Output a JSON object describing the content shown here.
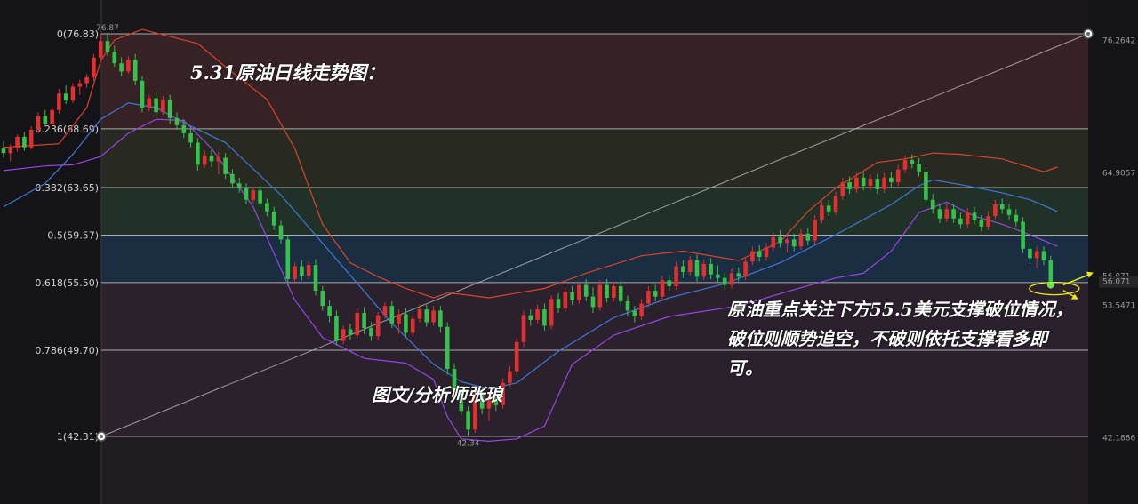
{
  "title": "5.31原油日线走势图：",
  "author": "图文/分析师张琅",
  "comment": "原油重点关注下方55.5美元支撑破位情况，破位则顺势追空，不破则依托支撑看多即可。",
  "colors": {
    "background": "#141317",
    "up": "#e0302f",
    "down": "#34c24a",
    "ma_mid": "#3e78d8",
    "band_upper": "#d8452c",
    "band_lower": "#9846e4",
    "fib_line": "#d9d9d9",
    "zone_top": "#3a2526",
    "zone_mid1": "#2a2e24",
    "zone_mid2": "#23352a",
    "zone_mid3": "#1b3146",
    "zone_bottom": "#2c2330",
    "arrow": "#e8e81c"
  },
  "chart_data": {
    "type": "candlestick",
    "title": "",
    "ylim": [
      39.0,
      78.0
    ],
    "fib_levels": [
      {
        "ratio": "0",
        "price": 76.83,
        "label": "0(76.83)"
      },
      {
        "ratio": "0.236",
        "price": 68.69,
        "label": "0.236(68.69)"
      },
      {
        "ratio": "0.382",
        "price": 63.65,
        "label": "0.382(63.65)"
      },
      {
        "ratio": "0.5",
        "price": 59.57,
        "label": "0.5(59.57)"
      },
      {
        "ratio": "0.618",
        "price": 55.5,
        "label": "0.618(55.50)"
      },
      {
        "ratio": "0.786",
        "price": 49.7,
        "label": "0.786(49.70)"
      },
      {
        "ratio": "1",
        "price": 42.31,
        "label": "1(42.31)"
      }
    ],
    "price_scale_labels": [
      "76.2642",
      "64.9057",
      "56.071",
      "53.5471",
      "42.1886"
    ],
    "extreme_labels": {
      "high": "76.87",
      "low": "42.34"
    },
    "candles": [
      [
        67.0,
        67.6,
        66.2,
        66.6
      ],
      [
        66.6,
        67.4,
        65.9,
        67.0
      ],
      [
        67.0,
        68.2,
        66.7,
        68.0
      ],
      [
        68.0,
        68.4,
        66.8,
        67.1
      ],
      [
        67.1,
        68.9,
        66.9,
        68.6
      ],
      [
        68.6,
        70.1,
        68.3,
        69.8
      ],
      [
        69.8,
        70.3,
        68.9,
        69.1
      ],
      [
        69.1,
        70.6,
        68.8,
        70.3
      ],
      [
        70.3,
        72.1,
        70.0,
        71.7
      ],
      [
        71.7,
        72.4,
        70.8,
        71.1
      ],
      [
        71.1,
        72.6,
        70.9,
        72.3
      ],
      [
        72.3,
        72.9,
        71.6,
        72.6
      ],
      [
        72.6,
        73.4,
        72.2,
        73.1
      ],
      [
        73.1,
        75.1,
        72.8,
        74.8
      ],
      [
        74.8,
        76.87,
        74.4,
        76.2
      ],
      [
        76.2,
        76.9,
        74.9,
        75.3
      ],
      [
        75.3,
        75.8,
        74.0,
        74.3
      ],
      [
        74.3,
        74.8,
        73.2,
        73.6
      ],
      [
        73.6,
        74.9,
        73.4,
        74.6
      ],
      [
        74.6,
        75.1,
        72.4,
        72.8
      ],
      [
        72.8,
        73.2,
        70.1,
        70.5
      ],
      [
        70.5,
        71.6,
        70.2,
        71.3
      ],
      [
        71.3,
        71.9,
        69.8,
        70.1
      ],
      [
        70.1,
        71.5,
        69.9,
        71.2
      ],
      [
        71.2,
        71.6,
        69.1,
        69.6
      ],
      [
        69.6,
        70.1,
        68.6,
        69.0
      ],
      [
        69.0,
        69.5,
        67.9,
        68.3
      ],
      [
        68.3,
        68.8,
        67.1,
        67.5
      ],
      [
        67.5,
        67.9,
        65.1,
        65.6
      ],
      [
        65.6,
        66.8,
        65.3,
        66.4
      ],
      [
        66.4,
        66.9,
        65.4,
        65.9
      ],
      [
        65.9,
        66.7,
        64.8,
        66.2
      ],
      [
        66.2,
        66.6,
        64.4,
        64.8
      ],
      [
        64.8,
        65.2,
        63.6,
        64.0
      ],
      [
        64.0,
        64.5,
        63.2,
        63.6
      ],
      [
        63.6,
        64.0,
        62.2,
        62.6
      ],
      [
        62.6,
        63.7,
        62.3,
        63.4
      ],
      [
        63.4,
        63.8,
        61.9,
        62.3
      ],
      [
        62.3,
        62.7,
        61.2,
        61.6
      ],
      [
        61.6,
        62.0,
        60.0,
        60.4
      ],
      [
        60.4,
        60.8,
        58.8,
        59.2
      ],
      [
        59.2,
        59.6,
        55.2,
        55.8
      ],
      [
        55.8,
        57.2,
        55.4,
        56.9
      ],
      [
        56.9,
        57.4,
        55.7,
        56.1
      ],
      [
        56.1,
        57.3,
        55.8,
        57.0
      ],
      [
        57.0,
        57.5,
        54.4,
        54.8
      ],
      [
        54.8,
        55.2,
        53.1,
        53.5
      ],
      [
        53.5,
        54.0,
        52.1,
        52.6
      ],
      [
        52.6,
        53.1,
        50.1,
        50.5
      ],
      [
        50.5,
        51.8,
        50.2,
        51.5
      ],
      [
        51.5,
        52.0,
        50.6,
        51.0
      ],
      [
        51.0,
        53.3,
        50.7,
        52.9
      ],
      [
        52.9,
        53.4,
        51.1,
        51.6
      ],
      [
        51.6,
        52.1,
        50.5,
        50.9
      ],
      [
        50.9,
        53.0,
        50.6,
        52.7
      ],
      [
        52.7,
        53.8,
        52.4,
        53.5
      ],
      [
        53.5,
        53.9,
        51.6,
        52.0
      ],
      [
        52.0,
        53.2,
        51.1,
        52.8
      ],
      [
        52.8,
        53.3,
        50.8,
        51.2
      ],
      [
        51.2,
        52.7,
        50.9,
        52.4
      ],
      [
        52.4,
        53.6,
        52.1,
        53.2
      ],
      [
        53.2,
        53.6,
        51.7,
        52.1
      ],
      [
        52.1,
        53.5,
        51.8,
        53.1
      ],
      [
        53.1,
        53.5,
        51.2,
        51.7
      ],
      [
        51.7,
        52.1,
        47.6,
        48.1
      ],
      [
        48.1,
        48.6,
        45.8,
        46.3
      ],
      [
        46.3,
        46.7,
        44.1,
        44.5
      ],
      [
        44.5,
        44.9,
        42.34,
        42.9
      ],
      [
        42.9,
        46.4,
        42.6,
        46.0
      ],
      [
        46.0,
        46.5,
        44.2,
        44.7
      ],
      [
        44.7,
        46.1,
        43.6,
        45.7
      ],
      [
        45.7,
        46.2,
        44.5,
        45.0
      ],
      [
        45.0,
        47.3,
        44.7,
        46.9
      ],
      [
        46.9,
        48.3,
        46.6,
        47.9
      ],
      [
        47.9,
        50.8,
        47.6,
        50.4
      ],
      [
        50.4,
        53.1,
        50.0,
        52.7
      ],
      [
        52.7,
        53.2,
        51.8,
        52.3
      ],
      [
        52.3,
        53.6,
        52.0,
        53.2
      ],
      [
        53.2,
        53.7,
        51.4,
        51.8
      ],
      [
        51.8,
        54.4,
        51.5,
        54.1
      ],
      [
        54.1,
        54.6,
        52.9,
        53.3
      ],
      [
        53.3,
        55.1,
        53.0,
        54.7
      ],
      [
        54.7,
        55.2,
        53.6,
        54.0
      ],
      [
        54.0,
        55.6,
        53.7,
        55.3
      ],
      [
        55.3,
        55.8,
        53.9,
        54.3
      ],
      [
        54.3,
        55.1,
        52.9,
        53.4
      ],
      [
        53.4,
        55.7,
        53.1,
        55.3
      ],
      [
        55.3,
        55.8,
        53.8,
        54.2
      ],
      [
        54.2,
        55.6,
        53.9,
        55.2
      ],
      [
        55.2,
        55.6,
        53.5,
        53.9
      ],
      [
        53.9,
        54.4,
        52.6,
        53.1
      ],
      [
        53.1,
        53.5,
        52.1,
        52.6
      ],
      [
        52.6,
        54.1,
        52.3,
        53.7
      ],
      [
        53.7,
        55.2,
        53.4,
        54.8
      ],
      [
        54.8,
        55.3,
        53.9,
        54.3
      ],
      [
        54.3,
        56.1,
        54.0,
        55.7
      ],
      [
        55.7,
        56.2,
        54.8,
        55.2
      ],
      [
        55.2,
        57.3,
        54.9,
        56.9
      ],
      [
        56.9,
        57.4,
        55.9,
        56.4
      ],
      [
        56.4,
        57.8,
        56.1,
        57.4
      ],
      [
        57.4,
        57.9,
        55.6,
        56.0
      ],
      [
        56.0,
        57.5,
        55.7,
        57.1
      ],
      [
        57.1,
        57.6,
        55.8,
        56.2
      ],
      [
        56.2,
        57.0,
        55.5,
        55.9
      ],
      [
        55.9,
        56.4,
        54.9,
        55.3
      ],
      [
        55.3,
        56.7,
        55.0,
        56.3
      ],
      [
        56.3,
        56.8,
        55.6,
        56.0
      ],
      [
        56.0,
        57.7,
        55.7,
        57.3
      ],
      [
        57.3,
        58.6,
        57.0,
        58.2
      ],
      [
        58.2,
        58.7,
        57.3,
        57.7
      ],
      [
        57.7,
        58.9,
        57.4,
        58.5
      ],
      [
        58.5,
        59.8,
        58.2,
        59.4
      ],
      [
        59.4,
        60.0,
        58.5,
        58.9
      ],
      [
        58.9,
        59.6,
        58.1,
        59.2
      ],
      [
        59.2,
        59.7,
        58.2,
        58.6
      ],
      [
        58.6,
        60.1,
        58.3,
        59.7
      ],
      [
        59.7,
        60.2,
        58.7,
        59.1
      ],
      [
        59.1,
        61.3,
        58.8,
        60.9
      ],
      [
        60.9,
        62.5,
        60.6,
        62.1
      ],
      [
        62.1,
        62.6,
        61.2,
        61.6
      ],
      [
        61.6,
        63.3,
        61.3,
        62.9
      ],
      [
        62.9,
        64.5,
        62.6,
        64.1
      ],
      [
        64.1,
        64.6,
        63.1,
        63.5
      ],
      [
        63.5,
        64.9,
        63.2,
        64.5
      ],
      [
        64.5,
        65.0,
        63.4,
        63.8
      ],
      [
        63.8,
        64.8,
        63.4,
        64.4
      ],
      [
        64.4,
        64.8,
        63.1,
        63.5
      ],
      [
        63.5,
        64.9,
        63.2,
        64.5
      ],
      [
        64.5,
        65.0,
        63.7,
        64.1
      ],
      [
        64.1,
        65.6,
        63.8,
        65.2
      ],
      [
        65.2,
        66.4,
        64.9,
        66.0
      ],
      [
        66.0,
        66.5,
        65.3,
        65.7
      ],
      [
        65.7,
        66.2,
        64.6,
        65.0
      ],
      [
        65.0,
        65.4,
        62.2,
        62.6
      ],
      [
        62.6,
        63.1,
        61.4,
        61.8
      ],
      [
        61.8,
        62.3,
        60.6,
        61.0
      ],
      [
        61.0,
        62.2,
        60.7,
        61.8
      ],
      [
        61.8,
        62.2,
        60.6,
        61.0
      ],
      [
        61.0,
        61.5,
        60.1,
        60.5
      ],
      [
        60.5,
        61.9,
        60.2,
        61.5
      ],
      [
        61.5,
        62.0,
        60.5,
        60.9
      ],
      [
        60.9,
        61.3,
        59.9,
        60.3
      ],
      [
        60.3,
        61.6,
        60.0,
        61.2
      ],
      [
        61.2,
        62.6,
        60.9,
        62.2
      ],
      [
        62.2,
        62.7,
        61.4,
        61.8
      ],
      [
        61.8,
        62.2,
        60.9,
        61.3
      ],
      [
        61.3,
        61.8,
        60.3,
        60.7
      ],
      [
        60.7,
        61.1,
        58.0,
        58.4
      ],
      [
        58.4,
        58.9,
        57.1,
        57.6
      ],
      [
        57.6,
        58.6,
        56.8,
        58.2
      ],
      [
        58.2,
        58.6,
        57.0,
        57.4
      ],
      [
        57.4,
        57.8,
        55.3,
        55.6
      ]
    ],
    "ma_mid": [
      [
        0,
        62.0
      ],
      [
        6,
        64.0
      ],
      [
        10,
        66.5
      ],
      [
        14,
        69.5
      ],
      [
        18,
        70.9
      ],
      [
        22,
        70.5
      ],
      [
        26,
        69.2
      ],
      [
        32,
        67.5
      ],
      [
        40,
        63.0
      ],
      [
        48,
        57.5
      ],
      [
        56,
        52.0
      ],
      [
        62,
        48.5
      ],
      [
        66,
        47.0
      ],
      [
        70,
        46.4
      ],
      [
        74,
        46.9
      ],
      [
        80,
        49.6
      ],
      [
        88,
        52.5
      ],
      [
        96,
        54.2
      ],
      [
        104,
        55.4
      ],
      [
        112,
        57.2
      ],
      [
        120,
        59.6
      ],
      [
        128,
        62.2
      ],
      [
        132,
        63.8
      ],
      [
        134,
        64.3
      ],
      [
        138,
        63.9
      ],
      [
        144,
        63.2
      ],
      [
        148,
        62.6
      ],
      [
        152,
        61.6
      ]
    ],
    "band_upper": [
      [
        0,
        67.1
      ],
      [
        8,
        67.4
      ],
      [
        12,
        70.5
      ],
      [
        14,
        74.5
      ],
      [
        16,
        76.3
      ],
      [
        20,
        77.2
      ],
      [
        22,
        76.9
      ],
      [
        28,
        76.0
      ],
      [
        32,
        74.0
      ],
      [
        38,
        71.2
      ],
      [
        42,
        67.0
      ],
      [
        46,
        60.5
      ],
      [
        50,
        57.2
      ],
      [
        54,
        56.0
      ],
      [
        58,
        55.0
      ],
      [
        62,
        54.2
      ],
      [
        64,
        54.6
      ],
      [
        66,
        54.5
      ],
      [
        70,
        54.2
      ],
      [
        74,
        54.6
      ],
      [
        78,
        55.0
      ],
      [
        84,
        56.3
      ],
      [
        92,
        57.8
      ],
      [
        98,
        58.2
      ],
      [
        106,
        57.4
      ],
      [
        112,
        59.0
      ],
      [
        116,
        61.6
      ],
      [
        120,
        63.6
      ],
      [
        126,
        65.8
      ],
      [
        130,
        66.1
      ],
      [
        134,
        66.6
      ],
      [
        138,
        66.5
      ],
      [
        144,
        66.1
      ],
      [
        150,
        65.0
      ],
      [
        152,
        65.4
      ]
    ],
    "band_lower": [
      [
        0,
        65.1
      ],
      [
        6,
        65.5
      ],
      [
        10,
        65.6
      ],
      [
        14,
        66.3
      ],
      [
        18,
        68.3
      ],
      [
        22,
        69.5
      ],
      [
        26,
        69.4
      ],
      [
        30,
        67.0
      ],
      [
        36,
        62.0
      ],
      [
        42,
        54.0
      ],
      [
        46,
        50.8
      ],
      [
        52,
        49.0
      ],
      [
        58,
        48.6
      ],
      [
        62,
        47.2
      ],
      [
        64,
        44.0
      ],
      [
        66,
        42.1
      ],
      [
        70,
        41.9
      ],
      [
        74,
        42.1
      ],
      [
        78,
        43.2
      ],
      [
        82,
        48.5
      ],
      [
        88,
        51.0
      ],
      [
        96,
        52.6
      ],
      [
        106,
        53.5
      ],
      [
        114,
        54.9
      ],
      [
        120,
        55.9
      ],
      [
        124,
        56.3
      ],
      [
        128,
        58.2
      ],
      [
        132,
        61.5
      ],
      [
        136,
        62.4
      ],
      [
        140,
        61.2
      ],
      [
        144,
        60.5
      ],
      [
        148,
        59.6
      ],
      [
        152,
        58.6
      ]
    ]
  }
}
